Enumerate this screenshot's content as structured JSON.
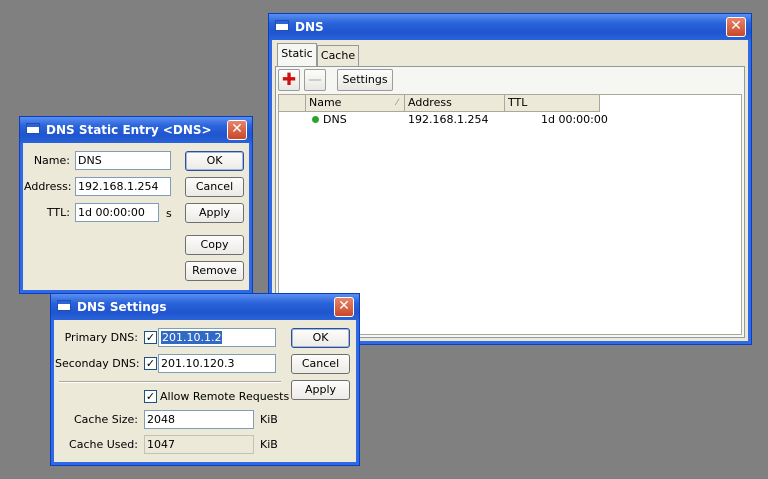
{
  "dns_window": {
    "title": "DNS",
    "tabs": [
      "Static",
      "Cache"
    ],
    "toolbar": {
      "add_icon": "plus-icon",
      "remove_icon": "minus-icon",
      "settings_label": "Settings"
    },
    "columns": [
      "Name",
      "Address",
      "TTL"
    ],
    "rows": [
      {
        "name": "DNS",
        "address": "192.168.1.254",
        "ttl": "1d 00:00:00",
        "status_color": "#2aa52a"
      }
    ]
  },
  "static_entry": {
    "title": "DNS Static Entry <DNS>",
    "name_label": "Name:",
    "name_value": "DNS",
    "address_label": "Address:",
    "address_value": "192.168.1.254",
    "ttl_label": "TTL:",
    "ttl_value": "1d 00:00:00",
    "ttl_unit": "s",
    "ok_label": "OK",
    "cancel_label": "Cancel",
    "apply_label": "Apply",
    "copy_label": "Copy",
    "remove_label": "Remove"
  },
  "settings": {
    "title": "DNS Settings",
    "primary_label": "Primary DNS:",
    "primary_value": "201.10.1.2",
    "primary_checked": true,
    "secondary_label": "Seconday DNS:",
    "secondary_value": "201.10.120.3",
    "secondary_checked": true,
    "allow_remote_label": "Allow Remote Requests",
    "allow_remote_checked": true,
    "cache_size_label": "Cache Size:",
    "cache_size_value": "2048",
    "cache_size_unit": "KiB",
    "cache_used_label": "Cache Used:",
    "cache_used_value": "1047",
    "cache_used_unit": "KiB",
    "ok_label": "OK",
    "cancel_label": "Cancel",
    "apply_label": "Apply"
  },
  "colors": {
    "titlebar": "#2a63da",
    "close": "#c8482a",
    "selection": "#316ac5",
    "add": "#d01010"
  }
}
